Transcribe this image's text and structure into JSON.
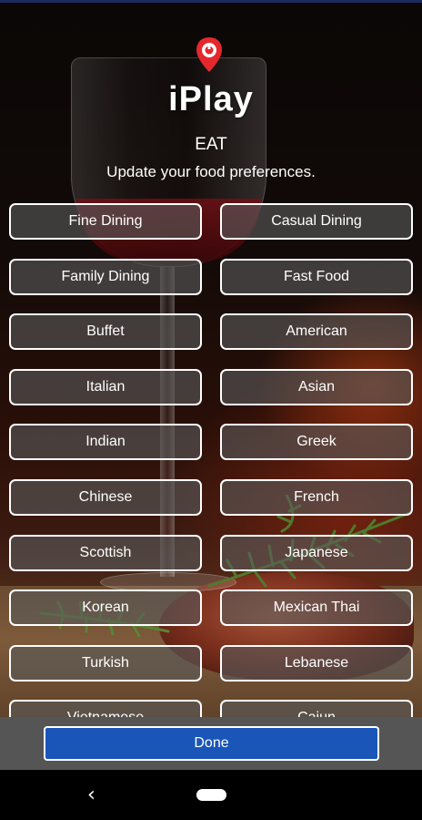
{
  "header": {
    "logo_icon": "location-pin-logo-icon",
    "app_title": "iPlay",
    "section_title": "EAT",
    "subtitle": "Update your food preferences."
  },
  "options": [
    {
      "label": "Fine Dining"
    },
    {
      "label": "Casual Dining"
    },
    {
      "label": "Family Dining"
    },
    {
      "label": "Fast Food"
    },
    {
      "label": "Buffet"
    },
    {
      "label": "American"
    },
    {
      "label": "Italian"
    },
    {
      "label": "Asian"
    },
    {
      "label": "Indian"
    },
    {
      "label": "Greek"
    },
    {
      "label": "Chinese"
    },
    {
      "label": "French"
    },
    {
      "label": "Scottish"
    },
    {
      "label": "Japanese"
    },
    {
      "label": "Korean"
    },
    {
      "label": "Mexican  Thai"
    },
    {
      "label": "Turkish"
    },
    {
      "label": "Lebanese"
    },
    {
      "label": "Vietnamese"
    },
    {
      "label": "Cajun"
    }
  ],
  "footer": {
    "done_label": "Done"
  },
  "navigation": {
    "back_icon": "back-chevron-icon",
    "home_icon": "home-pill-icon"
  },
  "colors": {
    "accent_button": "#1a56b8",
    "logo_red": "#e4282d",
    "option_fill": "#5a5a5a",
    "bottom_bar": "#555555"
  }
}
